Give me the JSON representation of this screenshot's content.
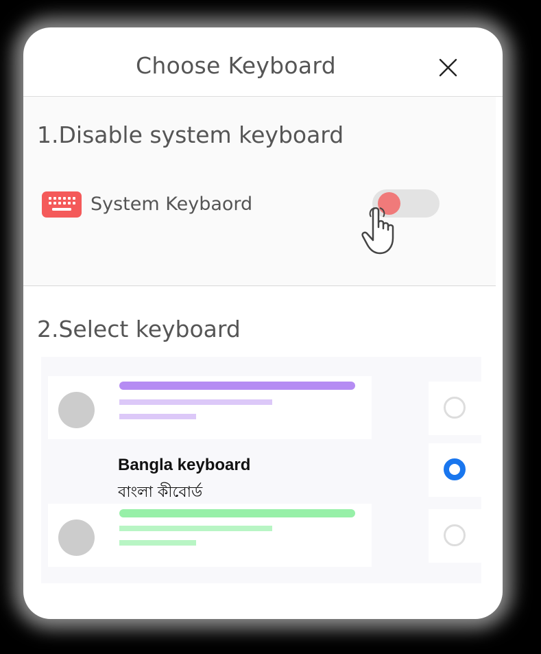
{
  "dialog": {
    "title": "Choose Keyboard",
    "close_icon": "close-icon"
  },
  "step1": {
    "title": "1.Disable system keyboard",
    "item_label": "System Keybaord",
    "item_icon": "keyboard-icon",
    "toggle_on": false,
    "pointer_icon": "hand-pointer-icon"
  },
  "step2": {
    "title": "2.Select keyboard",
    "keyboards": [
      {
        "type": "placeholder",
        "accent": "#b58cf3",
        "selected": false
      },
      {
        "type": "named",
        "name": "Bangla keyboard",
        "native_name": "বাংলা কীবোর্ড",
        "selected": true
      },
      {
        "type": "placeholder",
        "accent": "#97f0a8",
        "selected": false
      }
    ]
  },
  "colors": {
    "keyboard_icon": "#f45a5a",
    "radio_selected": "#1976ee",
    "toggle_knob": "#f07a7a"
  }
}
